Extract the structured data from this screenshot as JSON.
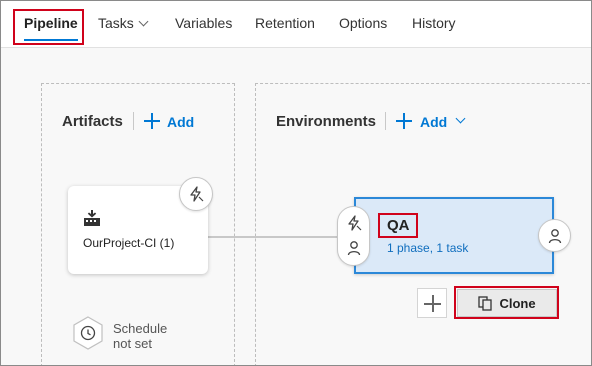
{
  "tabs": [
    {
      "label": "Pipeline",
      "active": true
    },
    {
      "label": "Tasks",
      "has_dropdown": true
    },
    {
      "label": "Variables"
    },
    {
      "label": "Retention"
    },
    {
      "label": "Options"
    },
    {
      "label": "History"
    }
  ],
  "artifacts": {
    "title": "Artifacts",
    "add_label": "Add",
    "card": {
      "label": "OurProject-CI (1)",
      "icon": "build-icon",
      "trigger_icon": "lightning-icon"
    },
    "schedule": {
      "line1": "Schedule",
      "line2": "not set",
      "icon": "clock-icon"
    }
  },
  "environments": {
    "title": "Environments",
    "add_label": "Add",
    "card": {
      "name": "QA",
      "summary": "1 phase, 1 task"
    },
    "clone_label": "Clone"
  },
  "colors": {
    "accent": "#0078d4",
    "highlight": "#d0021b",
    "env_fill": "#dbe9f8",
    "env_border": "#2b88d8"
  }
}
